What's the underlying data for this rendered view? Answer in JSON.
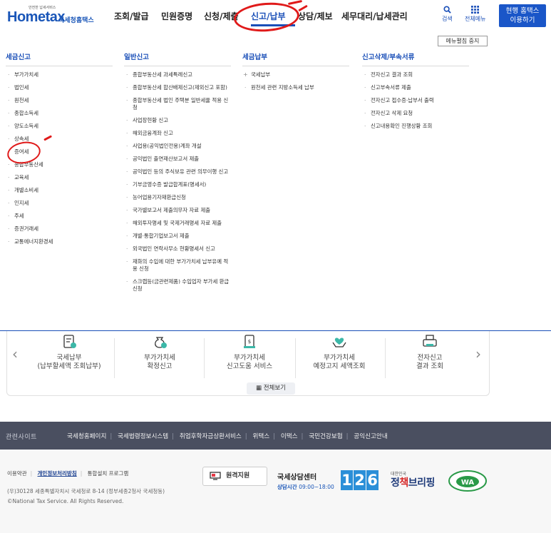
{
  "header": {
    "logo": {
      "tagline": "안전한 납세서비스",
      "name": "Hometax",
      "sub": "국세청홈택스"
    },
    "nav": [
      {
        "label": "조회/발급"
      },
      {
        "label": "민원증명"
      },
      {
        "label": "신청/제출"
      },
      {
        "label": "신고/납부",
        "active": true
      },
      {
        "label": "상담/제보"
      },
      {
        "label": "세무대리/납세관리"
      }
    ],
    "utils": {
      "search": "검색",
      "all_menu": "전체메뉴"
    },
    "branch_button": [
      "현행 홈택스",
      "이용하기"
    ],
    "menu_stop": "메뉴펼침 중지"
  },
  "megamenu": {
    "col1": {
      "title": "세금신고",
      "items": [
        "부가가치세",
        "법인세",
        "원천세",
        "종합소득세",
        "양도소득세",
        "상속세",
        "증여세",
        "종합부동산세",
        "교육세",
        "개별소비세",
        "인지세",
        "주세",
        "증권거래세",
        "교통에너지환경세"
      ]
    },
    "col2": {
      "title": "일반신고",
      "items": [
        "종합부동산세 과세특례신고",
        "종합부동산세 합산배제신고(제외신고 포함)",
        "종합부동산세 법인 주택분 일반세율 적용 신청",
        "사업장현황 신고",
        "해외금융계좌 신고",
        "사업용(공익법인전용)계좌 개설",
        "공익법인 출연재산보고서 제출",
        "공익법인 등의 주식보유 관련 의무이행 신고",
        "기부금영수증 발급합계표(명세서)",
        "농어업용기자재환급신청",
        "국가별보고서 제출의무자 자료 제출",
        "해외투자명세 및 국제거래명세 자료 제출",
        "개별·통합기업보고서 제출",
        "외국법인 연락사무소 현황명세서 신고",
        "재화의 수입에 대한 부가가치세 납부유예 적용 신청",
        "스크랩등(금관련제품) 수입업자 부가세 환급신청"
      ]
    },
    "col3": {
      "title": "세금납부",
      "items": [
        "국세납부",
        "원천세 관련 지방소득세 납부"
      ]
    },
    "col4": {
      "title": "신고삭제/부속서류",
      "items": [
        "전자신고 결과 조회",
        "신고부속서류 제출",
        "전자신고 접수증·납부서 출력",
        "전자신고 삭제 요청",
        "신고내용확인 진행상황 조회"
      ]
    }
  },
  "quick": {
    "items": [
      {
        "line1": "국세납부",
        "line2": "(납부할세액 조회납부)",
        "icon": "tax-payment-icon"
      },
      {
        "line1": "부가가치세",
        "line2": "확정신고",
        "icon": "vat-money-bag-icon"
      },
      {
        "line1": "부가가치세",
        "line2": "신고도움 서비스",
        "icon": "vat-document-icon"
      },
      {
        "line1": "부가가치세",
        "line2": "예정고지 세액조회",
        "icon": "heart-hands-icon"
      },
      {
        "line1": "전자신고",
        "line2": "결과 조회",
        "icon": "printer-document-icon"
      }
    ],
    "all_view": "전체보기"
  },
  "related": {
    "label": "관련사이트",
    "links": [
      "국세청홈페이지",
      "국세법령정보시스템",
      "취업후학자금상환서비스",
      "위택스",
      "이택스",
      "국민건강보험",
      "공익신고안내"
    ]
  },
  "footer": {
    "links": [
      "이용약관",
      "개인정보처리방침",
      "통합설치 프로그램"
    ],
    "address": "(우)30128 세종특별자치시 국세청로 8-14 (정부세종2청사 국세청동)",
    "copyright": "©National Tax Service. All Rights Reserved.",
    "remote": "원격지원",
    "center_title": "국세상담센터",
    "center_time_label": "상담시간",
    "center_time": "09:00~18:00",
    "number": [
      "1",
      "2",
      "6"
    ],
    "jb_small": "대한민국",
    "jb_main_a": "정",
    "jb_main_b": "책",
    "jb_main_c": "브리핑",
    "wa_text": "WA"
  },
  "colors": {
    "brand": "#1a4fb8",
    "annotation": "#e01a1a",
    "band": "#4a4f60"
  }
}
